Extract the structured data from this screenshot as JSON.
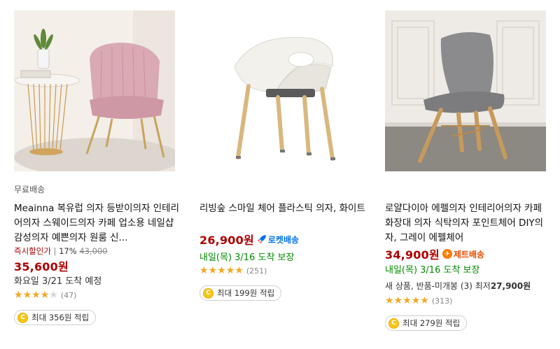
{
  "products": [
    {
      "shipping_label": "무료배송",
      "title": "Meainna 복유럽 의자 등받이의자 인테리어의자 스웨이드의자 카페 업소용 네일샵 감성의자 예쁜의자 원룸 신...",
      "sale_label": "즉시할인가",
      "discount": "17%",
      "original_price": "43,000",
      "price": "35,600원",
      "arrival": "화요일 3/21 도착 예정",
      "rating_stars": 4.5,
      "review_count": "(47)",
      "reward": "최대 356원 적립"
    },
    {
      "title": "리빙숲 스마일 체어 플라스틱 의자, 화이트",
      "price": "26,900원",
      "badge": "로켓배송",
      "arrival": "내일(목) 3/16 도착 보장",
      "rating_stars": 4.5,
      "review_count": "(251)",
      "reward": "최대 199원 적립"
    },
    {
      "title": "로얄다이아 에펠의자 인테리어의자 카페 화장대 의자 식탁의자 포인트체어 DIY의자, 그레이 에펠체어",
      "price": "34,900원",
      "badge": "제트배송",
      "arrival": "내일(목) 3/16 도착 보장",
      "extra_prefix": "새 상품, 반품-미개봉 (3) 최저",
      "extra_price": "27,900원",
      "rating_stars": 4.5,
      "review_count": "(313)",
      "reward": "최대 279원 적립"
    }
  ],
  "colors": {
    "price": "#ae0000",
    "rocket": "#0073e9",
    "jet": "#e64c00",
    "guarantee": "#008c00",
    "star": "#f5a623"
  }
}
